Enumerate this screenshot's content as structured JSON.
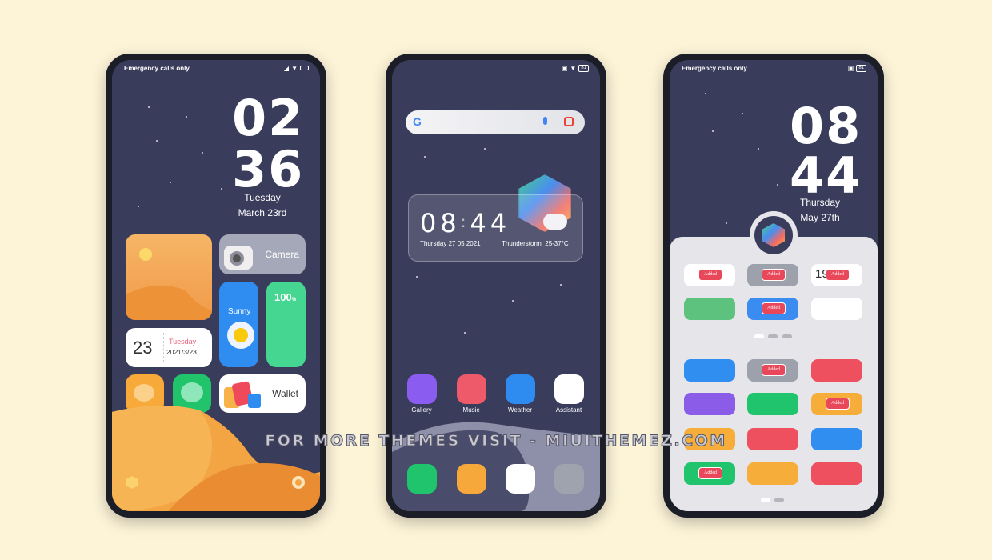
{
  "phone1": {
    "status_text": "Emergency calls only",
    "clock_hours": "02",
    "clock_minutes": "36",
    "day": "Tuesday",
    "date": "March 23rd",
    "camera_label": "Camera",
    "weather_label": "Sunny",
    "battery_value": "100",
    "battery_unit": "%",
    "calendar_day": "23",
    "calendar_weekday": "Tuesday",
    "calendar_date": "2021/3/23",
    "wallet_label": "Wallet"
  },
  "phone2": {
    "battery": "81",
    "search_logo": "G",
    "clock_hours": "08",
    "clock_minutes": "44",
    "clock_date": "Thursday 27 05 2021",
    "weather": "Thunderstorm  25-37°C",
    "apps": [
      {
        "label": "Gallery",
        "color": "#8b5cf0"
      },
      {
        "label": "Music",
        "color": "#ef5a6a"
      },
      {
        "label": "Weather",
        "color": "#2e8cf0"
      },
      {
        "label": "Assistant",
        "color": "#ffffff"
      }
    ],
    "dock": [
      {
        "name": "phone",
        "color": "#1fc46d"
      },
      {
        "name": "messages",
        "color": "#f6a93a"
      },
      {
        "name": "chrome",
        "color": "#ffffff"
      },
      {
        "name": "camera",
        "color": "#9ea3ad"
      }
    ]
  },
  "phone3": {
    "status_text": "Emergency calls only",
    "battery": "81",
    "clock_hours": "08",
    "clock_minutes": "44",
    "day": "Thursday",
    "date": "May 27th",
    "added_label": "Added",
    "tiles_top": [
      {
        "color": "#ffffff",
        "added": true
      },
      {
        "color": "#9ca1ab",
        "added": true
      },
      {
        "color": "#ffffff",
        "added": true,
        "text": "19"
      },
      {
        "color": "#5ec27f",
        "added": false
      },
      {
        "color": "#3b8cf0",
        "added": true
      },
      {
        "color": "#ffffff",
        "added": false
      }
    ],
    "tiles_bottom": [
      {
        "color": "#2f8ef0",
        "added": false
      },
      {
        "color": "#9ca1ab",
        "added": true
      },
      {
        "color": "#ef5060",
        "added": false
      },
      {
        "color": "#8b5ce8",
        "added": false
      },
      {
        "color": "#1fc46d",
        "added": false
      },
      {
        "color": "#f6ad3a",
        "added": true
      },
      {
        "color": "#f6ad3a",
        "added": false
      },
      {
        "color": "#ef5060",
        "added": false
      },
      {
        "color": "#2f8ef0",
        "added": false
      },
      {
        "color": "#1fc46d",
        "added": true
      },
      {
        "color": "#f6ad3a",
        "added": false
      },
      {
        "color": "#ef5060",
        "added": false
      }
    ]
  },
  "watermark": "FOR MORE THEMES VISIT - MIUITHEMEZ.COM"
}
